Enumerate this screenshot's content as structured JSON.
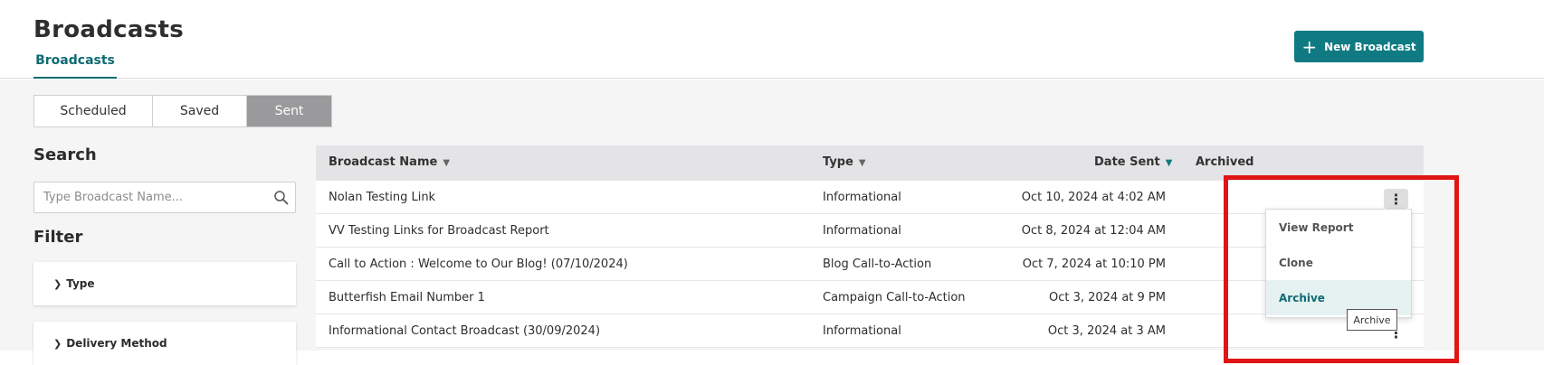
{
  "header": {
    "title": "Broadcasts",
    "subtab": "Broadcasts",
    "new_button": "New Broadcast"
  },
  "segments": [
    "Scheduled",
    "Saved",
    "Sent"
  ],
  "active_segment": "Sent",
  "search": {
    "label": "Search",
    "placeholder": "Type Broadcast Name..."
  },
  "filter": {
    "label": "Filter",
    "items": [
      "Type",
      "Delivery Method"
    ]
  },
  "table": {
    "columns": [
      "Broadcast Name",
      "Type",
      "Date Sent",
      "Archived"
    ],
    "sort_column": "Date Sent",
    "rows": [
      {
        "name": "Nolan Testing Link",
        "type": "Informational",
        "date": "Oct 10, 2024 at 4:02 AM"
      },
      {
        "name": "VV Testing Links for Broadcast Report",
        "type": "Informational",
        "date": "Oct 8, 2024 at 12:04 AM"
      },
      {
        "name": "Call to Action : Welcome to Our Blog! (07/10/2024)",
        "type": "Blog Call-to-Action",
        "date": "Oct 7, 2024 at 10:10 PM"
      },
      {
        "name": "Butterfish Email Number 1",
        "type": "Campaign Call-to-Action",
        "date": "Oct 3, 2024 at 9 PM"
      },
      {
        "name": "Informational Contact Broadcast (30/09/2024)",
        "type": "Informational",
        "date": "Oct 3, 2024 at 3 AM"
      }
    ]
  },
  "menu": {
    "items": [
      "View Report",
      "Clone",
      "Archive"
    ],
    "highlighted": "Archive"
  },
  "tooltip": "Archive",
  "colors": {
    "accent": "#0f7a82",
    "highlight_box": "#e01515",
    "active_segment": "#9a9a9c"
  }
}
